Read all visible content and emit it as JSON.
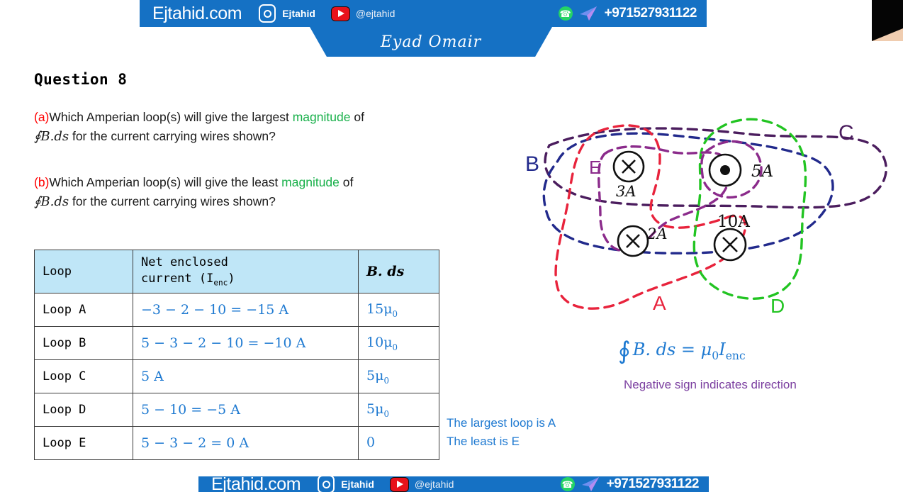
{
  "banner": {
    "site": "Ejtahid.com",
    "instagram_icon": "instagram-icon",
    "instagram_name": "Ejtahid",
    "youtube_icon": "youtube-icon",
    "youtube_handle": "@ejtahid",
    "whatsapp_icon": "whatsapp-icon",
    "telegram_icon": "telegram-icon",
    "phone": "+971527931122",
    "presenter": "Eyad Omair",
    "accent_color": "#1571c4"
  },
  "question": {
    "title": "Question 8",
    "part_a": {
      "label": "(a)",
      "text_1": "Which Amperian loop(s) will give the largest ",
      "highlight": "magnitude",
      "text_2": " of",
      "line2_math": "∮B.ds",
      "line2_rest": " for the current carrying wires shown?"
    },
    "part_b": {
      "label": "(b)",
      "text_1": "Which Amperian loop(s) will give the least ",
      "highlight": "magnitude",
      "text_2": " of",
      "line2_math": "∮B.ds",
      "line2_rest": " for the current carrying wires shown?"
    },
    "label_color": "#ff0000",
    "highlight_color": "#18b04a"
  },
  "table": {
    "headers": {
      "loop": "Loop",
      "current_line1": "Net enclosed",
      "current_line2": "current  (I",
      "current_sub": "enc",
      "current_line3": ")",
      "bds": "B. ds"
    },
    "header_bg": "#bfe6f7",
    "value_color": "#1f7ad1",
    "rows": [
      {
        "loop": "Loop A",
        "current": "−3 − 2 − 10 = −15 A",
        "bds_num": "15",
        "bds_unit": "μ",
        "bds_sub": "0"
      },
      {
        "loop": "Loop B",
        "current": "5 − 3 − 2 − 10 = −10 A",
        "bds_num": "10",
        "bds_unit": "μ",
        "bds_sub": "0"
      },
      {
        "loop": "Loop C",
        "current": "5 A",
        "bds_num": "5",
        "bds_unit": "μ",
        "bds_sub": "0"
      },
      {
        "loop": "Loop D",
        "current": "5 − 10 = −5 A",
        "bds_num": "5",
        "bds_unit": "μ",
        "bds_sub": "0"
      },
      {
        "loop": "Loop E",
        "current": "5 − 3 − 2 = 0 A",
        "bds_num": "0",
        "bds_unit": "",
        "bds_sub": ""
      }
    ]
  },
  "answers": {
    "line1": "The largest loop is A",
    "line2": "The least is E",
    "color": "#1f7ad1"
  },
  "formula": {
    "symbol": "∮",
    "lhs": "B. ds = ",
    "mu": "μ",
    "mu_sub": "0",
    "i": "I",
    "i_sub": "enc",
    "color": "#1f7ad1"
  },
  "note": {
    "text": "Negative sign indicates direction",
    "color": "#7b3fa0"
  },
  "diagram": {
    "loops": [
      {
        "name": "A",
        "label": "A",
        "color": "#e8233c"
      },
      {
        "name": "B",
        "label": "B",
        "color": "#222a8c"
      },
      {
        "name": "C",
        "label": "C",
        "color": "#4b1d5e"
      },
      {
        "name": "D",
        "label": "D",
        "color": "#22c422"
      },
      {
        "name": "E",
        "label": "E",
        "color": "#8b2b8b"
      }
    ],
    "wires": [
      {
        "label": "3A",
        "direction": "into-page",
        "glyph": "x"
      },
      {
        "label": "2A",
        "direction": "into-page",
        "glyph": "x"
      },
      {
        "label": "5A",
        "direction": "out-of-page",
        "glyph": "dot"
      },
      {
        "label": "10A",
        "direction": "into-page",
        "glyph": "x"
      }
    ]
  }
}
